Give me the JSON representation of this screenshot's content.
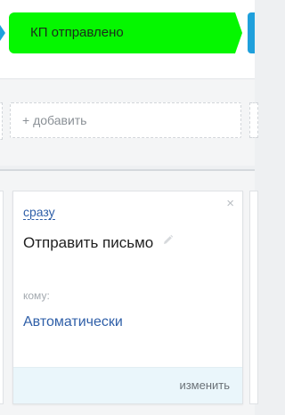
{
  "pipeline": {
    "stage_label": "КП отправлено",
    "stage_color": "#05f700",
    "neighbor_stage_color": "#1fa0dc"
  },
  "add_section": {
    "add_label": "+ добавить"
  },
  "task_card": {
    "timing_label": "сразу",
    "title": "Отправить письмо",
    "to_label": "кому:",
    "to_value": "Автоматически",
    "change_label": "изменить",
    "close_glyph": "×",
    "icons": {
      "close": "close-icon",
      "edit": "pencil-icon"
    }
  }
}
